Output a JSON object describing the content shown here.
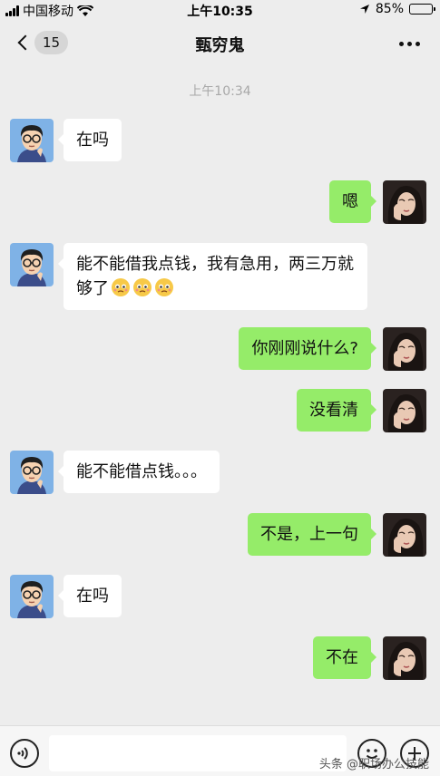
{
  "status_bar": {
    "carrier": "中国移动",
    "time": "上午10:35",
    "battery": "85%",
    "battery_level": 0.85
  },
  "nav": {
    "unread_count": "15",
    "title": "甄穷鬼"
  },
  "timestamp": "上午10:34",
  "messages": [
    {
      "side": "left",
      "text": "在吗"
    },
    {
      "side": "right",
      "text": "嗯"
    },
    {
      "side": "left",
      "text": "能不能借我点钱，我有急用，两三万就够了"
    },
    {
      "side": "right",
      "text": "你刚刚说什么?"
    },
    {
      "side": "right",
      "text": "没看清"
    },
    {
      "side": "left",
      "text": "能不能借点钱。。。"
    },
    {
      "side": "right",
      "text": "不是，上一句"
    },
    {
      "side": "left",
      "text": "在吗"
    },
    {
      "side": "right",
      "text": "不在"
    }
  ],
  "watermark": "头条 @职场办公技能",
  "colors": {
    "background": "#ededed",
    "bubble_sent": "#95ec69",
    "bubble_received": "#ffffff"
  },
  "icons": [
    "back-chevron-icon",
    "more-icon",
    "voice-icon",
    "emoji-icon",
    "plus-icon"
  ]
}
